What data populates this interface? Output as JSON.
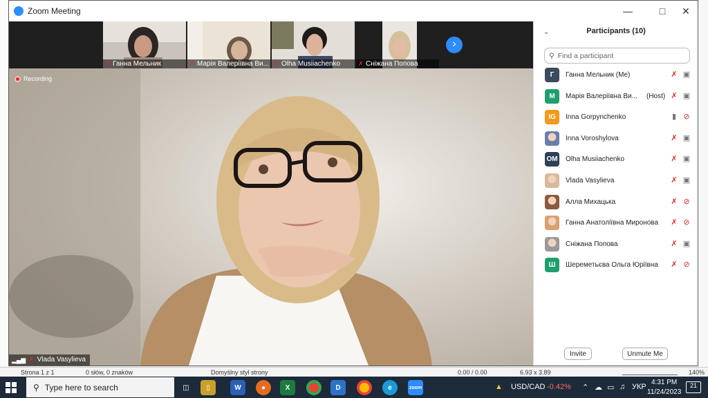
{
  "window": {
    "title": "Zoom Meeting",
    "minimize_icon": "minimize-icon",
    "maximize_icon": "maximize-icon",
    "close_icon": "close-icon"
  },
  "thumbnails": [
    {
      "name": "Ганна Мельник"
    },
    {
      "name": "Марія Валеріївна Ви..."
    },
    {
      "name": "Olha Musiiachenko"
    },
    {
      "name": "Сніжана Попова"
    }
  ],
  "main_video": {
    "recording_label": "Recording",
    "speaker_name": "Vlada Vasylieva"
  },
  "participants": {
    "title": "Participants (10)",
    "search_placeholder": "Find a participant",
    "list": [
      {
        "initials": "Г",
        "name": "Ганна Мельник (Me)",
        "avatar_color": "#3b4a5e",
        "mic": "muted",
        "video": "on"
      },
      {
        "initials": "М",
        "name": "Марія Валеріївна Ви...",
        "role": "(Host)",
        "avatar_color": "#1f9e6e",
        "mic": "muted",
        "video": "on"
      },
      {
        "initials": "IG",
        "name": "Inna Gorpynchenko",
        "avatar_color": "#f29a1b",
        "mic": "on",
        "video": "off"
      },
      {
        "initials": "",
        "name": "Inna Voroshylova",
        "avatar_color": "#6a7fb0",
        "mic": "muted",
        "video": "on"
      },
      {
        "initials": "OM",
        "name": "Olha Musiiachenko",
        "avatar_color": "#2f3f55",
        "mic": "muted",
        "video": "on"
      },
      {
        "initials": "",
        "name": "Vlada Vasylieva",
        "avatar_color": "#d9b99a",
        "mic": "muted",
        "video": "on"
      },
      {
        "initials": "",
        "name": "Алла Михацька",
        "avatar_color": "#8a5a3c",
        "mic": "muted",
        "video": "off"
      },
      {
        "initials": "",
        "name": "Ганна Анатоліївна Миронова",
        "avatar_color": "#d9a070",
        "mic": "muted",
        "video": "off"
      },
      {
        "initials": "",
        "name": "Сніжана Попова",
        "avatar_color": "#9a9a9a",
        "mic": "muted",
        "video": "on"
      },
      {
        "initials": "Ш",
        "name": "Шереметьєва Ольга Юріївна",
        "avatar_color": "#1f9e6e",
        "mic": "muted",
        "video": "off"
      }
    ],
    "invite_label": "Invite",
    "unmute_label": "Unmute Me"
  },
  "statusbar": {
    "page": "Strona 1 z 1",
    "words": "0 słów, 0 znaków",
    "style": "Domyślny styl strony",
    "position": "0.00 / 0.00",
    "size": "6.93 x 3.89",
    "zoom": "140%"
  },
  "taskbar": {
    "search_placeholder": "Type here to search",
    "ticker_symbol": "USD/CAD",
    "ticker_change": "-0.42%",
    "language": "УКР",
    "time": "4:31 PM",
    "date": "11/24/2023",
    "notifications": "21"
  }
}
